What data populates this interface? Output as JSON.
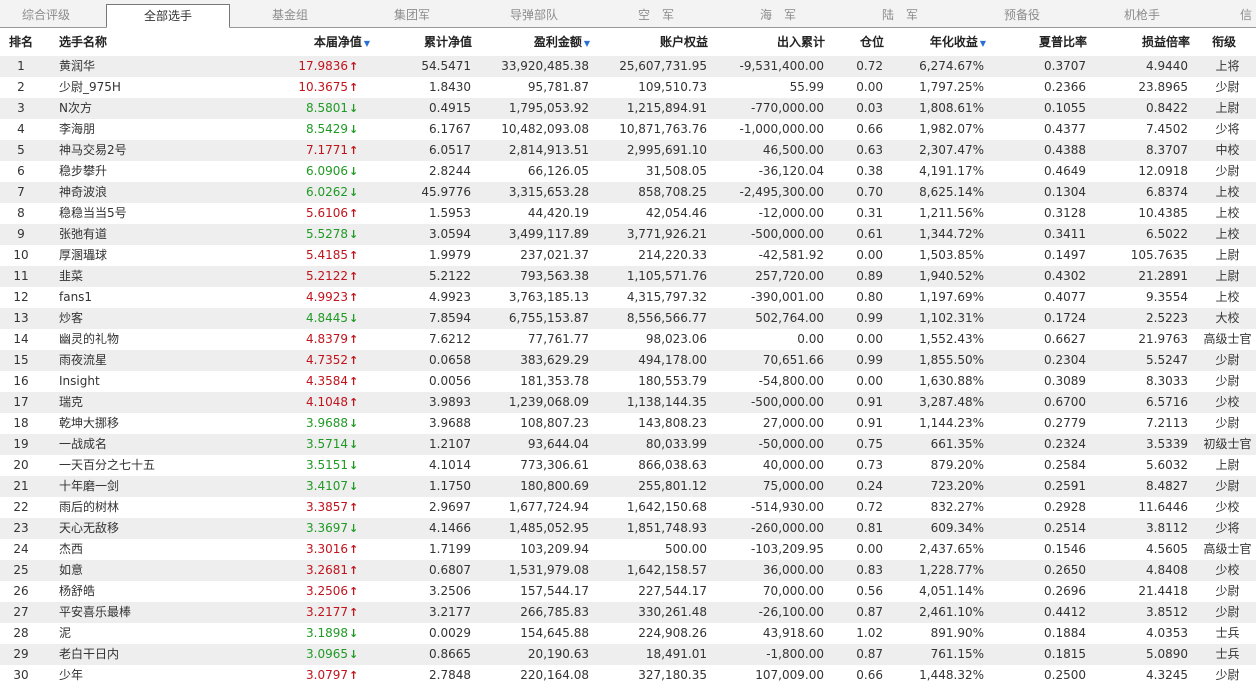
{
  "tabs": [
    "综合评级",
    "全部选手",
    "基金组",
    "集团军",
    "导弹部队",
    "空　军",
    "海　军",
    "陆　军",
    "预备役",
    "机枪手",
    "信"
  ],
  "active_tab": 1,
  "headers": {
    "rank": "排名",
    "name": "选手名称",
    "nav": "本届净值",
    "cum_nav": "累计净值",
    "profit": "盈利金额",
    "equity": "账户权益",
    "flow": "出入累计",
    "position": "仓位",
    "annual": "年化收益",
    "sharpe": "夏普比率",
    "pl_ratio": "损益倍率",
    "rank_title": "衔级"
  },
  "colors": {
    "up": "#c0141d",
    "down": "#1f9a24",
    "sort": "#2a6fd4",
    "stripe": "#eeeeee"
  },
  "rows": [
    {
      "rank": "1",
      "name": "黄润华",
      "nav": "17.9836",
      "dir": "up",
      "cum": "54.5471",
      "profit": "33,920,485.38",
      "equity": "25,607,731.95",
      "flow": "-9,531,400.00",
      "pos": "0.72",
      "annual": "6,274.67%",
      "sharpe": "0.3707",
      "pl": "4.9440",
      "title": "上将"
    },
    {
      "rank": "2",
      "name": "少尉_975H",
      "nav": "10.3675",
      "dir": "up",
      "cum": "1.8430",
      "profit": "95,781.87",
      "equity": "109,510.73",
      "flow": "55.99",
      "pos": "0.00",
      "annual": "1,797.25%",
      "sharpe": "0.2366",
      "pl": "23.8965",
      "title": "少尉"
    },
    {
      "rank": "3",
      "name": "N次方",
      "nav": "8.5801",
      "dir": "down",
      "cum": "0.4915",
      "profit": "1,795,053.92",
      "equity": "1,215,894.91",
      "flow": "-770,000.00",
      "pos": "0.03",
      "annual": "1,808.61%",
      "sharpe": "0.1055",
      "pl": "0.8422",
      "title": "上尉"
    },
    {
      "rank": "4",
      "name": "李海朋",
      "nav": "8.5429",
      "dir": "down",
      "cum": "6.1767",
      "profit": "10,482,093.08",
      "equity": "10,871,763.76",
      "flow": "-1,000,000.00",
      "pos": "0.66",
      "annual": "1,982.07%",
      "sharpe": "0.4377",
      "pl": "7.4502",
      "title": "少将"
    },
    {
      "rank": "5",
      "name": "神马交易2号",
      "nav": "7.1771",
      "dir": "up",
      "cum": "6.0517",
      "profit": "2,814,913.51",
      "equity": "2,995,691.10",
      "flow": "46,500.00",
      "pos": "0.63",
      "annual": "2,307.47%",
      "sharpe": "0.4388",
      "pl": "8.3707",
      "title": "中校"
    },
    {
      "rank": "6",
      "name": "稳步攀升",
      "nav": "6.0906",
      "dir": "down",
      "cum": "2.8244",
      "profit": "66,126.05",
      "equity": "31,508.05",
      "flow": "-36,120.04",
      "pos": "0.38",
      "annual": "4,191.17%",
      "sharpe": "0.4649",
      "pl": "12.0918",
      "title": "少尉"
    },
    {
      "rank": "7",
      "name": "神奇波浪",
      "nav": "6.0262",
      "dir": "down",
      "cum": "45.9776",
      "profit": "3,315,653.28",
      "equity": "858,708.25",
      "flow": "-2,495,300.00",
      "pos": "0.70",
      "annual": "8,625.14%",
      "sharpe": "0.1304",
      "pl": "6.8374",
      "title": "上校"
    },
    {
      "rank": "8",
      "name": "稳稳当当5号",
      "nav": "5.6106",
      "dir": "up",
      "cum": "1.5953",
      "profit": "44,420.19",
      "equity": "42,054.46",
      "flow": "-12,000.00",
      "pos": "0.31",
      "annual": "1,211.56%",
      "sharpe": "0.3128",
      "pl": "10.4385",
      "title": "上校"
    },
    {
      "rank": "9",
      "name": "张弛有道",
      "nav": "5.5278",
      "dir": "down",
      "cum": "3.0594",
      "profit": "3,499,117.89",
      "equity": "3,771,926.21",
      "flow": "-500,000.00",
      "pos": "0.61",
      "annual": "1,344.72%",
      "sharpe": "0.3411",
      "pl": "6.5022",
      "title": "上校"
    },
    {
      "rank": "10",
      "name": "厚溷瓃球",
      "nav": "5.4185",
      "dir": "up",
      "cum": "1.9979",
      "profit": "237,021.37",
      "equity": "214,220.33",
      "flow": "-42,581.92",
      "pos": "0.00",
      "annual": "1,503.85%",
      "sharpe": "0.1497",
      "pl": "105.7635",
      "title": "上尉"
    },
    {
      "rank": "11",
      "name": "韭菜",
      "nav": "5.2122",
      "dir": "up",
      "cum": "5.2122",
      "profit": "793,563.38",
      "equity": "1,105,571.76",
      "flow": "257,720.00",
      "pos": "0.89",
      "annual": "1,940.52%",
      "sharpe": "0.4302",
      "pl": "21.2891",
      "title": "上尉"
    },
    {
      "rank": "12",
      "name": "fans1",
      "nav": "4.9923",
      "dir": "up",
      "cum": "4.9923",
      "profit": "3,763,185.13",
      "equity": "4,315,797.32",
      "flow": "-390,001.00",
      "pos": "0.80",
      "annual": "1,197.69%",
      "sharpe": "0.4077",
      "pl": "9.3554",
      "title": "上校"
    },
    {
      "rank": "13",
      "name": "炒客",
      "nav": "4.8445",
      "dir": "down",
      "cum": "7.8594",
      "profit": "6,755,153.87",
      "equity": "8,556,566.77",
      "flow": "502,764.00",
      "pos": "0.99",
      "annual": "1,102.31%",
      "sharpe": "0.1724",
      "pl": "2.5223",
      "title": "大校"
    },
    {
      "rank": "14",
      "name": "幽灵的礼物",
      "nav": "4.8379",
      "dir": "up",
      "cum": "7.6212",
      "profit": "77,761.77",
      "equity": "98,023.06",
      "flow": "0.00",
      "pos": "0.00",
      "annual": "1,552.43%",
      "sharpe": "0.6627",
      "pl": "21.9763",
      "title": "高级士官"
    },
    {
      "rank": "15",
      "name": "雨夜流星",
      "nav": "4.7352",
      "dir": "up",
      "cum": "0.0658",
      "profit": "383,629.29",
      "equity": "494,178.00",
      "flow": "70,651.66",
      "pos": "0.99",
      "annual": "1,855.50%",
      "sharpe": "0.2304",
      "pl": "5.5247",
      "title": "少尉"
    },
    {
      "rank": "16",
      "name": "Insight",
      "nav": "4.3584",
      "dir": "up",
      "cum": "0.0056",
      "profit": "181,353.78",
      "equity": "180,553.79",
      "flow": "-54,800.00",
      "pos": "0.00",
      "annual": "1,630.88%",
      "sharpe": "0.3089",
      "pl": "8.3033",
      "title": "少尉"
    },
    {
      "rank": "17",
      "name": "瑞克",
      "nav": "4.1048",
      "dir": "up",
      "cum": "3.9893",
      "profit": "1,239,068.09",
      "equity": "1,138,144.35",
      "flow": "-500,000.00",
      "pos": "0.91",
      "annual": "3,287.48%",
      "sharpe": "0.6700",
      "pl": "6.5716",
      "title": "少校"
    },
    {
      "rank": "18",
      "name": "乾坤大挪移",
      "nav": "3.9688",
      "dir": "down",
      "cum": "3.9688",
      "profit": "108,807.23",
      "equity": "143,808.23",
      "flow": "27,000.00",
      "pos": "0.91",
      "annual": "1,144.23%",
      "sharpe": "0.2779",
      "pl": "7.2113",
      "title": "少尉"
    },
    {
      "rank": "19",
      "name": "一战成名",
      "nav": "3.5714",
      "dir": "down",
      "cum": "1.2107",
      "profit": "93,644.04",
      "equity": "80,033.99",
      "flow": "-50,000.00",
      "pos": "0.75",
      "annual": "661.35%",
      "sharpe": "0.2324",
      "pl": "3.5339",
      "title": "初级士官"
    },
    {
      "rank": "20",
      "name": "一天百分之七十五",
      "nav": "3.5151",
      "dir": "down",
      "cum": "4.1014",
      "profit": "773,306.61",
      "equity": "866,038.63",
      "flow": "40,000.00",
      "pos": "0.73",
      "annual": "879.20%",
      "sharpe": "0.2584",
      "pl": "5.6032",
      "title": "上尉"
    },
    {
      "rank": "21",
      "name": "十年磨一剑",
      "nav": "3.4107",
      "dir": "down",
      "cum": "1.1750",
      "profit": "180,800.69",
      "equity": "255,801.12",
      "flow": "75,000.00",
      "pos": "0.24",
      "annual": "723.20%",
      "sharpe": "0.2591",
      "pl": "8.4827",
      "title": "少尉"
    },
    {
      "rank": "22",
      "name": "雨后的树林",
      "nav": "3.3857",
      "dir": "up",
      "cum": "2.9697",
      "profit": "1,677,724.94",
      "equity": "1,642,150.68",
      "flow": "-514,930.00",
      "pos": "0.72",
      "annual": "832.27%",
      "sharpe": "0.2928",
      "pl": "11.6446",
      "title": "少校"
    },
    {
      "rank": "23",
      "name": "天心无敌移",
      "nav": "3.3697",
      "dir": "down",
      "cum": "4.1466",
      "profit": "1,485,052.95",
      "equity": "1,851,748.93",
      "flow": "-260,000.00",
      "pos": "0.81",
      "annual": "609.34%",
      "sharpe": "0.2514",
      "pl": "3.8112",
      "title": "少将"
    },
    {
      "rank": "24",
      "name": "杰西",
      "nav": "3.3016",
      "dir": "up",
      "cum": "1.7199",
      "profit": "103,209.94",
      "equity": "500.00",
      "flow": "-103,209.95",
      "pos": "0.00",
      "annual": "2,437.65%",
      "sharpe": "0.1546",
      "pl": "4.5605",
      "title": "高级士官"
    },
    {
      "rank": "25",
      "name": "如意",
      "nav": "3.2681",
      "dir": "up",
      "cum": "0.6807",
      "profit": "1,531,979.08",
      "equity": "1,642,158.57",
      "flow": "36,000.00",
      "pos": "0.83",
      "annual": "1,228.77%",
      "sharpe": "0.2650",
      "pl": "4.8408",
      "title": "少校"
    },
    {
      "rank": "26",
      "name": "杨舒皓",
      "nav": "3.2506",
      "dir": "up",
      "cum": "3.2506",
      "profit": "157,544.17",
      "equity": "227,544.17",
      "flow": "70,000.00",
      "pos": "0.56",
      "annual": "4,051.14%",
      "sharpe": "0.2696",
      "pl": "21.4418",
      "title": "少尉"
    },
    {
      "rank": "27",
      "name": "平安喜乐最棒",
      "nav": "3.2177",
      "dir": "up",
      "cum": "3.2177",
      "profit": "266,785.83",
      "equity": "330,261.48",
      "flow": "-26,100.00",
      "pos": "0.87",
      "annual": "2,461.10%",
      "sharpe": "0.4412",
      "pl": "3.8512",
      "title": "少尉"
    },
    {
      "rank": "28",
      "name": "泥",
      "nav": "3.1898",
      "dir": "down",
      "cum": "0.0029",
      "profit": "154,645.88",
      "equity": "224,908.26",
      "flow": "43,918.60",
      "pos": "1.02",
      "annual": "891.90%",
      "sharpe": "0.1884",
      "pl": "4.0353",
      "title": "士兵"
    },
    {
      "rank": "29",
      "name": "老白干日内",
      "nav": "3.0965",
      "dir": "down",
      "cum": "0.8665",
      "profit": "20,190.63",
      "equity": "18,491.01",
      "flow": "-1,800.00",
      "pos": "0.87",
      "annual": "761.15%",
      "sharpe": "0.1815",
      "pl": "5.0890",
      "title": "士兵"
    },
    {
      "rank": "30",
      "name": "少年",
      "nav": "3.0797",
      "dir": "up",
      "cum": "2.7848",
      "profit": "220,164.08",
      "equity": "327,180.35",
      "flow": "107,009.00",
      "pos": "0.66",
      "annual": "1,448.32%",
      "sharpe": "0.2500",
      "pl": "4.3245",
      "title": "少尉"
    }
  ]
}
